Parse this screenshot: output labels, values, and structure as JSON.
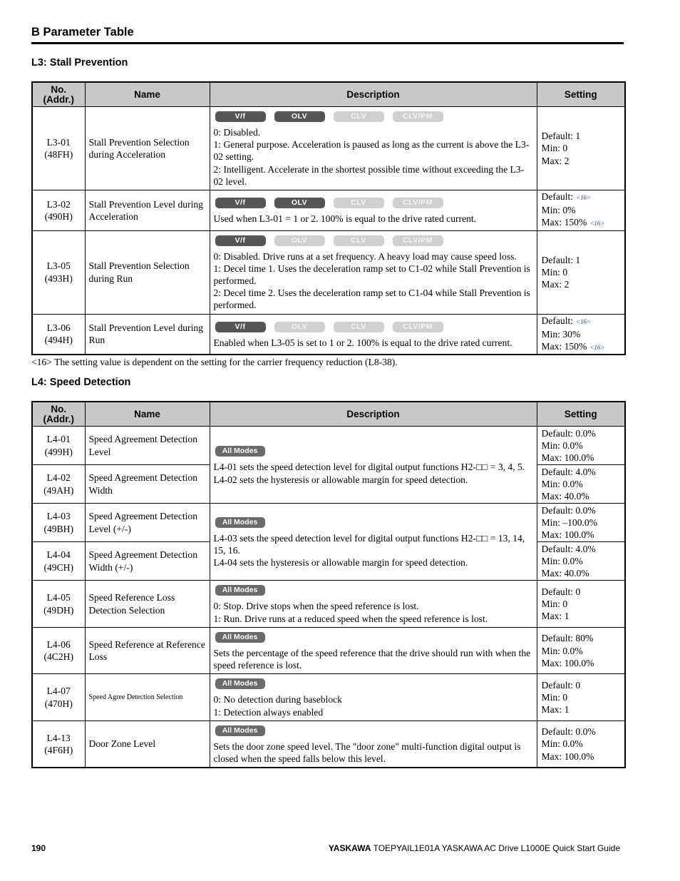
{
  "page": {
    "section_title": "B  Parameter Table",
    "footer": {
      "page_number": "190",
      "brand": "YASKAWA",
      "doc": " TOEPYAIL1E01A YASKAWA AC Drive L1000E Quick Start Guide"
    }
  },
  "headers": {
    "no": "No. (Addr.)",
    "no_line1": "No.",
    "no_line2": "(Addr.)",
    "name": "Name",
    "description": "Description",
    "setting": "Setting"
  },
  "l3": {
    "title": "L3: Stall Prevention",
    "footnote": "<16> The setting value is dependent on the setting for the carrier frequency reduction (L8-38).",
    "rows": [
      {
        "no": "L3-01",
        "addr": "(48FH)",
        "name": "Stall Prevention Selection during Acceleration",
        "modes": [
          {
            "label": "V/f",
            "active": true
          },
          {
            "label": "OLV",
            "active": true
          },
          {
            "label": "CLV",
            "active": false
          },
          {
            "label": "CLV/PM",
            "active": false
          }
        ],
        "desc": [
          "0: Disabled.",
          "1: General purpose. Acceleration is paused as long as the current is above the L3-02 setting.",
          "2: Intelligent. Accelerate in the shortest possible time without exceeding the L3-02 level."
        ],
        "setting": {
          "default": "Default: 1",
          "min": "Min: 0",
          "max": "Max: 2"
        }
      },
      {
        "no": "L3-02",
        "addr": "(490H)",
        "name": "Stall Prevention Level during Acceleration",
        "modes": [
          {
            "label": "V/f",
            "active": true
          },
          {
            "label": "OLV",
            "active": true
          },
          {
            "label": "CLV",
            "active": false
          },
          {
            "label": "CLV/PM",
            "active": false
          }
        ],
        "desc": [
          "Used when L3-01 = 1 or 2. 100% is equal to the drive rated current."
        ],
        "setting": {
          "default": "Default:",
          "default_ref": "<16>",
          "min": "Min: 0%",
          "max": "Max: 150%",
          "max_ref": "<16>"
        }
      },
      {
        "no": "L3-05",
        "addr": "(493H)",
        "name": "Stall Prevention Selection during Run",
        "modes": [
          {
            "label": "V/f",
            "active": true
          },
          {
            "label": "OLV",
            "active": false
          },
          {
            "label": "CLV",
            "active": false
          },
          {
            "label": "CLV/PM",
            "active": false
          }
        ],
        "desc": [
          "0: Disabled. Drive runs at a set frequency. A heavy load may cause speed loss.",
          "1: Decel time 1. Uses the deceleration ramp set to C1-02 while Stall Prevention is performed.",
          "2: Decel time 2. Uses the deceleration ramp set to C1-04 while Stall Prevention is performed."
        ],
        "setting": {
          "default": "Default: 1",
          "min": "Min: 0",
          "max": "Max: 2"
        }
      },
      {
        "no": "L3-06",
        "addr": "(494H)",
        "name": "Stall Prevention Level during Run",
        "modes": [
          {
            "label": "V/f",
            "active": true
          },
          {
            "label": "OLV",
            "active": false
          },
          {
            "label": "CLV",
            "active": false
          },
          {
            "label": "CLV/PM",
            "active": false
          }
        ],
        "desc": [
          "Enabled when L3-05 is set to 1 or 2. 100% is equal to the drive rated current."
        ],
        "setting": {
          "default": "Default:",
          "default_ref": "<16>",
          "min": "Min: 30%",
          "max": "Max: 150%",
          "max_ref": "<16>"
        }
      }
    ]
  },
  "l4": {
    "title": "L4: Speed Detection",
    "all_modes_label": "All Modes",
    "rows": [
      {
        "no": "L4-01",
        "addr": "(499H)",
        "name": "Speed Agreement Detection Level",
        "setting": {
          "default": "Default: 0.0%",
          "min": "Min: 0.0%",
          "max": "Max: 100.0%"
        }
      },
      {
        "no": "L4-02",
        "addr": "(49AH)",
        "name": "Speed Agreement Detection Width",
        "setting": {
          "default": "Default: 4.0%",
          "min": "Min: 0.0%",
          "max": "Max: 40.0%"
        }
      },
      {
        "no": "L4-03",
        "addr": "(49BH)",
        "name": "Speed Agreement Detection Level (+/-)",
        "setting": {
          "default": "Default: 0.0%",
          "min": "Min: –100.0%",
          "max": "Max: 100.0%"
        }
      },
      {
        "no": "L4-04",
        "addr": "(49CH)",
        "name": "Speed Agreement Detection Width (+/-)",
        "setting": {
          "default": "Default: 4.0%",
          "min": "Min: 0.0%",
          "max": "Max: 40.0%"
        }
      },
      {
        "no": "L4-05",
        "addr": "(49DH)",
        "name": "Speed Reference Loss Detection Selection",
        "desc": [
          "0: Stop. Drive stops when the speed reference is lost.",
          "1: Run. Drive runs at a reduced speed when the speed reference is lost."
        ],
        "setting": {
          "default": "Default: 0",
          "min": "Min: 0",
          "max": "Max: 1"
        }
      },
      {
        "no": "L4-06",
        "addr": "(4C2H)",
        "name": "Speed Reference at Reference Loss",
        "desc": [
          "Sets the percentage of the speed reference that the drive should run with when the speed reference is lost."
        ],
        "setting": {
          "default": "Default: 80%",
          "min": "Min: 0.0%",
          "max": "Max: 100.0%"
        }
      },
      {
        "no": "L4-07",
        "addr": "(470H)",
        "name": "Speed Agree Detection Selection",
        "desc": [
          "0: No detection during baseblock",
          "1: Detection always enabled"
        ],
        "setting": {
          "default": "Default: 0",
          "min": "Min: 0",
          "max": "Max: 1"
        }
      },
      {
        "no": "L4-13",
        "addr": "(4F6H)",
        "name": "Door Zone Level",
        "desc": [
          "Sets the door zone speed level. The \"door zone\" multi-function digital output is closed when the speed falls below this level."
        ],
        "setting": {
          "default": "Default: 0.0%",
          "min": "Min: 0.0%",
          "max": "Max: 100.0%"
        }
      }
    ],
    "group_desc": [
      [
        "L4-01 sets the speed detection level for digital output functions H2-□□ = 3, 4, 5.",
        "L4-02 sets the hysteresis or allowable margin for speed detection."
      ],
      [
        "L4-03 sets the speed detection level for digital output functions H2-□□ = 13, 14, 15, 16.",
        "L4-04 sets the hysteresis or allowable margin for speed detection."
      ]
    ]
  }
}
